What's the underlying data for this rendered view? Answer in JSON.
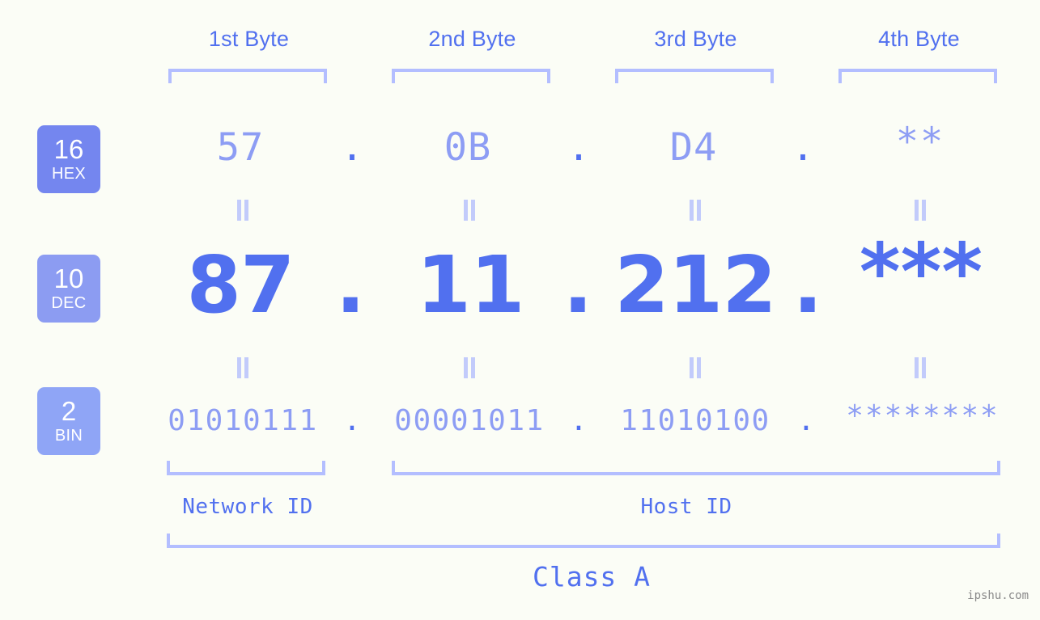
{
  "watermark": "ipshu.com",
  "colors": {
    "background": "#fbfdf6",
    "accent_strong": "#5170ef",
    "accent_soft": "#8d9df4",
    "bracket": "#b3beff",
    "eq_mark": "#c2cbfb",
    "badge_hex": "#7486ef",
    "badge_dec": "#8c9cf2",
    "badge_bin": "#8fa5f6",
    "watermark": "#8a8a8a"
  },
  "byte_headers": [
    {
      "label": "1st Byte"
    },
    {
      "label": "2nd Byte"
    },
    {
      "label": "3rd Byte"
    },
    {
      "label": "4th Byte"
    }
  ],
  "bases": [
    {
      "radix": "16",
      "name": "HEX"
    },
    {
      "radix": "10",
      "name": "DEC"
    },
    {
      "radix": "2",
      "name": "BIN"
    }
  ],
  "separator": ".",
  "rows": {
    "hex": {
      "radix": "16",
      "name": "HEX",
      "values": [
        "57",
        "0B",
        "D4",
        "**"
      ]
    },
    "dec": {
      "radix": "10",
      "name": "DEC",
      "values": [
        "87",
        "11",
        "212",
        "***"
      ]
    },
    "bin": {
      "radix": "2",
      "name": "BIN",
      "values": [
        "01010111",
        "00001011",
        "11010100",
        "********"
      ]
    }
  },
  "equality_symbol": "=",
  "sections": [
    {
      "label": "Network ID"
    },
    {
      "label": "Host ID"
    }
  ],
  "class": {
    "label": "Class A"
  },
  "chart_data": {
    "type": "table",
    "title": "IP Address Byte Breakdown",
    "columns": [
      "1st Byte",
      "2nd Byte",
      "3rd Byte",
      "4th Byte"
    ],
    "rows": [
      {
        "base": "HEX",
        "radix": 16,
        "values": [
          "57",
          "0B",
          "D4",
          "**"
        ]
      },
      {
        "base": "DEC",
        "radix": 10,
        "values": [
          "87",
          "11",
          "212",
          "***"
        ]
      },
      {
        "base": "BIN",
        "radix": 2,
        "values": [
          "01010111",
          "00001011",
          "11010100",
          "********"
        ]
      }
    ],
    "groups": [
      {
        "label": "Network ID",
        "bytes": [
          1
        ]
      },
      {
        "label": "Host ID",
        "bytes": [
          2,
          3,
          4
        ]
      },
      {
        "label": "Class A",
        "bytes": [
          1,
          2,
          3,
          4
        ]
      }
    ]
  }
}
